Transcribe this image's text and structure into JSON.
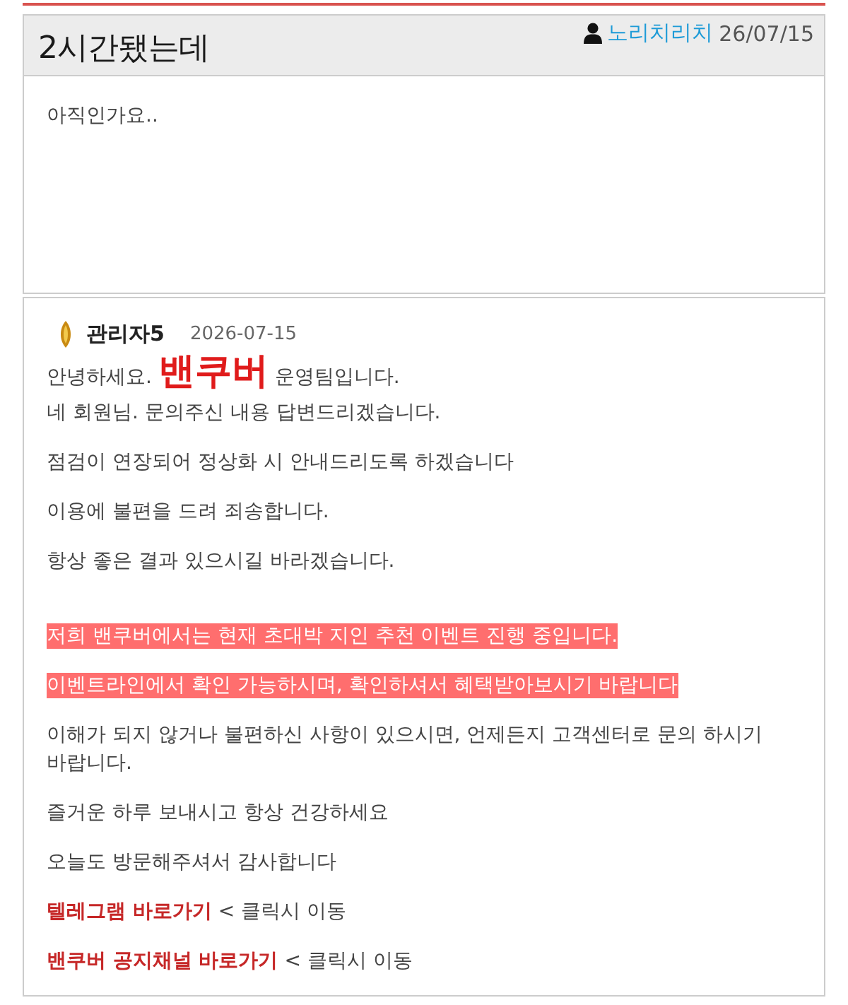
{
  "post": {
    "title": "2시간됐는데",
    "author": "노리치리치",
    "date": "26/07/15",
    "body": "아직인가요.."
  },
  "reply": {
    "author": "관리자5",
    "date": "2026-07-15",
    "blocks": [
      {
        "kind": "paragraph",
        "lines": [
          {
            "parts": [
              {
                "kind": "plain",
                "text": "안녕하세요."
              },
              {
                "kind": "brand",
                "text": "밴쿠버"
              },
              {
                "kind": "plain",
                "text": "운영팀입니다."
              }
            ]
          },
          "네 회원님. 문의주신 내용 답변드리겠습니다."
        ]
      },
      {
        "kind": "paragraph",
        "lines": [
          "점검이 연장되어 정상화 시 안내드리도록 하겠습니다"
        ]
      },
      {
        "kind": "paragraph",
        "lines": [
          "이용에 불편을 드려 죄송합니다."
        ]
      },
      {
        "kind": "paragraph",
        "lines": [
          "항상 좋은 결과 있으시길 바라겠습니다."
        ]
      },
      {
        "kind": "highlight",
        "lines": [
          "저희 밴쿠버에서는 현재 초대박 지인 추천 이벤트 진행 중입니다."
        ]
      },
      {
        "kind": "highlight",
        "lines": [
          "이벤트라인에서 확인 가능하시며, 확인하셔서 혜택받아보시기 바랍니다"
        ]
      },
      {
        "kind": "paragraph",
        "lines": [
          "이해가 되지 않거나 불편하신 사항이 있으시면, 언제든지 고객센터로 문의 하시기 바랍니다."
        ]
      },
      {
        "kind": "paragraph",
        "lines": [
          "즐거운 하루 보내시고 항상 건강하세요"
        ]
      },
      {
        "kind": "paragraph",
        "lines": [
          "오늘도 방문해주셔서 감사합니다"
        ]
      },
      {
        "kind": "link",
        "link": "텔레그램 바로가기",
        "hint": "< 클릭시 이동"
      },
      {
        "kind": "link",
        "link": "밴쿠버 공지채널 바로가기",
        "hint": "< 클릭시 이동"
      }
    ]
  }
}
